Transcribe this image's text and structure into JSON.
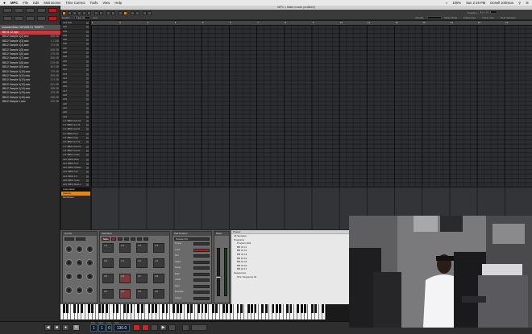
{
  "menubar": {
    "app_name": "MPC",
    "items": [
      "File",
      "Edit",
      "Metronome",
      "Time Correct",
      "Tools",
      "View",
      "Help"
    ],
    "clock": "Sun 2:19 PM",
    "user": "Donell Johnson",
    "battery": "100%"
  },
  "window": {
    "title": "MPC • Main mode (untitled)"
  },
  "browser": {
    "path": "Volumes/Mac HD/VMB 01 TEMPO",
    "files": [
      {
        "name": "BB 01 12.mpc",
        "size": ""
      },
      {
        "name": "BB12 Sample 1(2).wav",
        "size": "268 KB"
      },
      {
        "name": "BB12 Sample 1(3).wav",
        "size": "1.1 MB"
      },
      {
        "name": "BB12 Sample 1(4).wav",
        "size": "174 KB"
      },
      {
        "name": "BB12 Sample 1(5).wav",
        "size": "268 KB"
      },
      {
        "name": "BB12 Sample 1(6).wav",
        "size": "179 KB"
      },
      {
        "name": "BB12 Sample 1(7).wav",
        "size": "358 KB"
      },
      {
        "name": "BB12 Sample 1(8).wav",
        "size": "219 KB"
      },
      {
        "name": "BB12 Sample 1(9).wav",
        "size": "301 KB"
      },
      {
        "name": "BB12 Sample 1(10).wav",
        "size": "179 KB"
      },
      {
        "name": "BB12 Sample 1(11).wav",
        "size": "268 KB"
      },
      {
        "name": "BB12 Sample 1(12).wav",
        "size": "174 KB"
      },
      {
        "name": "BB12 Sample 1(13).wav",
        "size": "301 KB"
      },
      {
        "name": "BB12 Sample 1(14).wav",
        "size": "358 KB"
      },
      {
        "name": "BB12 Sample 1(15).wav",
        "size": "179 KB"
      },
      {
        "name": "BB12 Sample 1(16).wav",
        "size": "268 KB"
      },
      {
        "name": "BB12 Sample 1.wav",
        "size": "219 KB"
      }
    ]
  },
  "toolbar": {
    "header_label": "Header",
    "track_field": "Track 01",
    "snap_label": "Grid",
    "prog_label": "Program",
    "prog_value": "Drum Kit 1",
    "labels": [
      "Velocity",
      "Sticky Mode",
      "Follow play",
      "Track mute",
      "Note Variation"
    ]
  },
  "ruler": [
    "1",
    "2",
    "3",
    "4",
    "5",
    "6",
    "7",
    "8",
    "9",
    "10",
    "11",
    "12",
    "13",
    "14",
    "15",
    "16"
  ],
  "tracks": [
    "A01 Kick",
    "A02",
    "A03",
    "A04",
    "A05",
    "A06",
    "A07",
    "A08",
    "A09",
    "A10",
    "A11",
    "A12",
    "A13",
    "A14",
    "A15",
    "A16",
    "A17",
    "A18",
    "A19",
    "A20",
    "A21",
    "A22",
    "A23",
    "A 1: BB01 Kick 01",
    "A 2: BB01 Snr 01",
    "A 3: BB01 Hat 01",
    "A 4: BB01 Perc",
    "A 5: BB01 Clap",
    "A 6: BB01 Snr 02",
    "A 7: BB01 Kick 02",
    "A 8: BB01 Hat 02",
    "A 9: BB01 Crash",
    "A10: BB01 Ride",
    "A11: BB01 Tom",
    "A12: BB01 Shaker",
    "A13: BB01 Vox",
    "A14: BB01 FX",
    "A15: BB01 Snap",
    "A16: BB01 Bass 1"
  ],
  "lane": {
    "header": "Automation",
    "selected": "Velocity",
    "item2": "Modwheel"
  },
  "bottom": {
    "qlink_title": "Q-Link",
    "pad_title": "Pad Mute",
    "pads_bank": "Bank A",
    "pad_labels": [
      "A13",
      "A14",
      "A15",
      "A16",
      "A09",
      "A10",
      "A11",
      "A12",
      "A05",
      "A06",
      "A07",
      "A08",
      "A01",
      "A02",
      "A03",
      "A04"
    ],
    "sample_title": "Pad Params",
    "fields": [
      "Tuning",
      "Level",
      "Pan",
      "Attack",
      "Decay",
      "Filter",
      "Cutoff",
      "Reso",
      "Envelope",
      "Output"
    ],
    "program_name": "Program 001",
    "mixer_title": "Mixer"
  },
  "project": {
    "header": "Project",
    "items": [
      {
        "name": "All Samples",
        "level": 0
      },
      {
        "name": "Programs",
        "level": 0
      },
      {
        "name": "Program 001",
        "level": 1
      },
      {
        "name": "BB 01 11",
        "level": 1
      },
      {
        "name": "BB 01 12",
        "level": 1
      },
      {
        "name": "BB 01 13",
        "level": 1
      },
      {
        "name": "BB 01 14",
        "level": 1
      },
      {
        "name": "BB 01 15",
        "level": 1
      },
      {
        "name": "BB 01 16",
        "level": 1
      },
      {
        "name": "BB 01 17",
        "level": 1
      },
      {
        "name": "Sequences",
        "level": 0
      },
      {
        "name": "001: Sequence 01",
        "level": 1
      }
    ]
  },
  "transport": {
    "bar": "1",
    "beat": "1",
    "tick": "0",
    "bpm": "130.0",
    "labels": {
      "bars": "BAR",
      "beats": "BEAT",
      "ticks": "TICK",
      "tempo": "BPM"
    }
  }
}
